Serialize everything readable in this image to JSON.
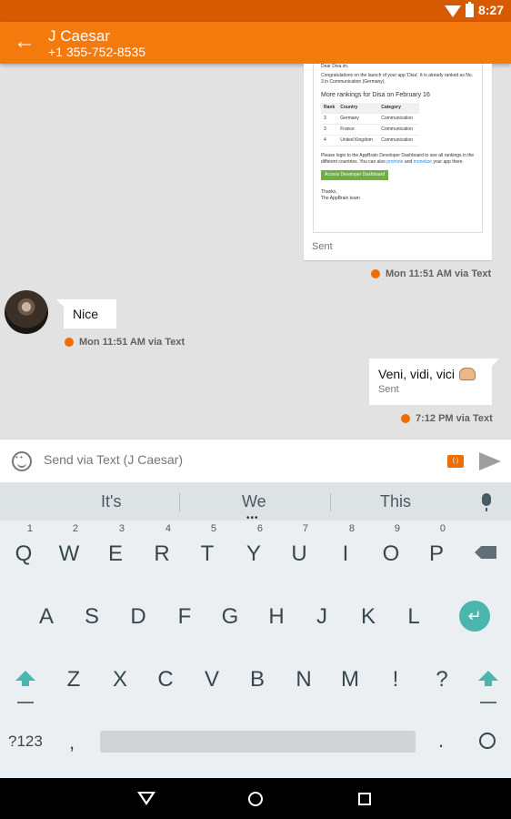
{
  "status_bar": {
    "time": "8:27"
  },
  "app_bar": {
    "back_icon": "arrow-left-icon",
    "title": "J Caesar",
    "subtitle": "+1 355-752-8535"
  },
  "messages": {
    "email": {
      "greeting": "Dear Disa.im,",
      "intro": "Congratulations on the launch of your app 'Disa'. It is already ranked as No. 3 in Communication (Germany).",
      "heading": "More rankings for Disa on February 16",
      "table_headers": [
        "Rank",
        "Country",
        "Category"
      ],
      "table_rows": [
        [
          "3",
          "Germany",
          "Communication"
        ],
        [
          "3",
          "France",
          "Communication"
        ],
        [
          "4",
          "United Kingdom",
          "Communication"
        ]
      ],
      "login_text": "Please login to the AppBrain Developer Dashboard to see all rankings in the different countries. You can also",
      "link_promote": "promote",
      "link_and": "and",
      "link_monetize": "monetize",
      "link_tail": "your app there.",
      "cta_label": "Access Developer Dashboard",
      "signoff_1": "Thanks,",
      "signoff_2": "The AppBrain team",
      "status": "Sent",
      "meta": "Mon 11:51 AM via Text"
    },
    "incoming": {
      "text": "Nice",
      "meta": "Mon 11:51 AM via Text"
    },
    "outgoing": {
      "text": "Veni, vidi, vici",
      "emoji": "flexed-biceps-emoji",
      "status": "Sent",
      "meta": "7:12 PM via Text"
    }
  },
  "compose": {
    "placeholder": "Send via Text (J Caesar)",
    "emoji_icon": "smiley-icon",
    "send_icon": "send-icon"
  },
  "keyboard": {
    "suggestions": [
      "It's",
      "We",
      "This"
    ],
    "row1": [
      {
        "k": "Q",
        "h": "1"
      },
      {
        "k": "W",
        "h": "2"
      },
      {
        "k": "E",
        "h": "3"
      },
      {
        "k": "R",
        "h": "4"
      },
      {
        "k": "T",
        "h": "5"
      },
      {
        "k": "Y",
        "h": "6"
      },
      {
        "k": "U",
        "h": "7"
      },
      {
        "k": "I",
        "h": "8"
      },
      {
        "k": "O",
        "h": "9"
      },
      {
        "k": "P",
        "h": "0"
      }
    ],
    "row2": [
      "A",
      "S",
      "D",
      "F",
      "G",
      "H",
      "J",
      "K",
      "L"
    ],
    "row3": [
      "Z",
      "X",
      "C",
      "V",
      "B",
      "N",
      "M",
      "!",
      "?"
    ],
    "symbols_key": "?123",
    "comma_key": ",",
    "period_key": "."
  },
  "colors": {
    "app_bar": "#f47a0e",
    "status_bar": "#d65a00",
    "accent_teal": "#4db6ac",
    "dot_orange": "#ef6c00"
  }
}
